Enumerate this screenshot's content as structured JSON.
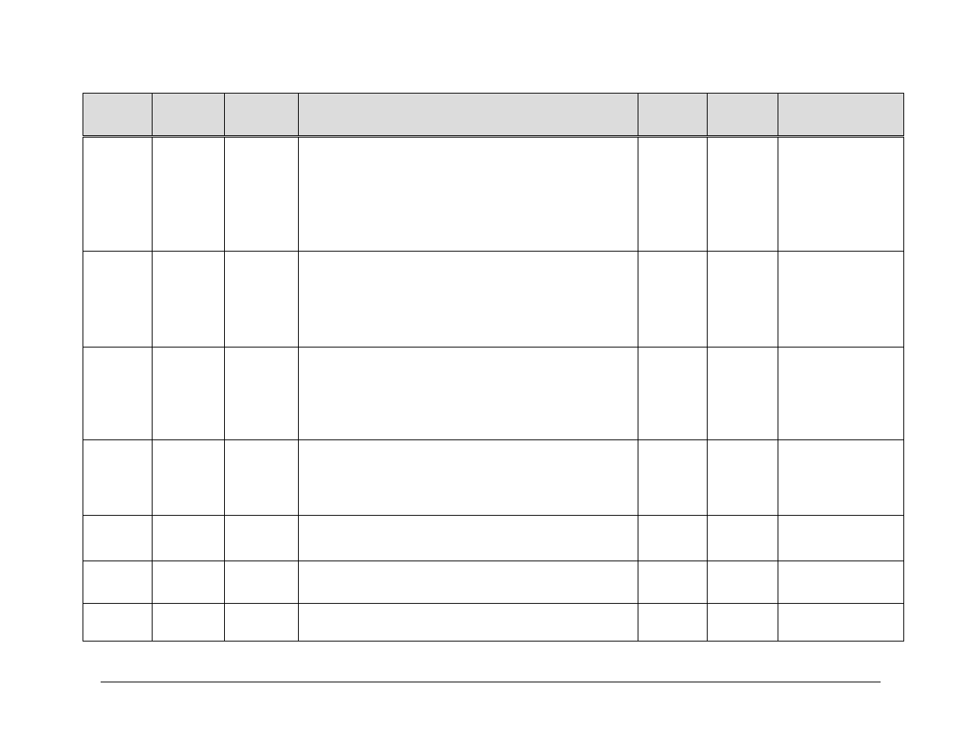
{
  "table": {
    "headers": [
      "",
      "",
      "",
      "",
      "",
      "",
      ""
    ],
    "rows": [
      [
        "",
        "",
        "",
        "",
        "",
        "",
        ""
      ],
      [
        "",
        "",
        "",
        "",
        "",
        "",
        ""
      ],
      [
        "",
        "",
        "",
        "",
        "",
        "",
        ""
      ],
      [
        "",
        "",
        "",
        "",
        "",
        "",
        ""
      ],
      [
        "",
        "",
        "",
        "",
        "",
        "",
        ""
      ],
      [
        "",
        "",
        "",
        "",
        "",
        "",
        ""
      ],
      [
        "",
        "",
        "",
        "",
        "",
        "",
        ""
      ]
    ]
  }
}
